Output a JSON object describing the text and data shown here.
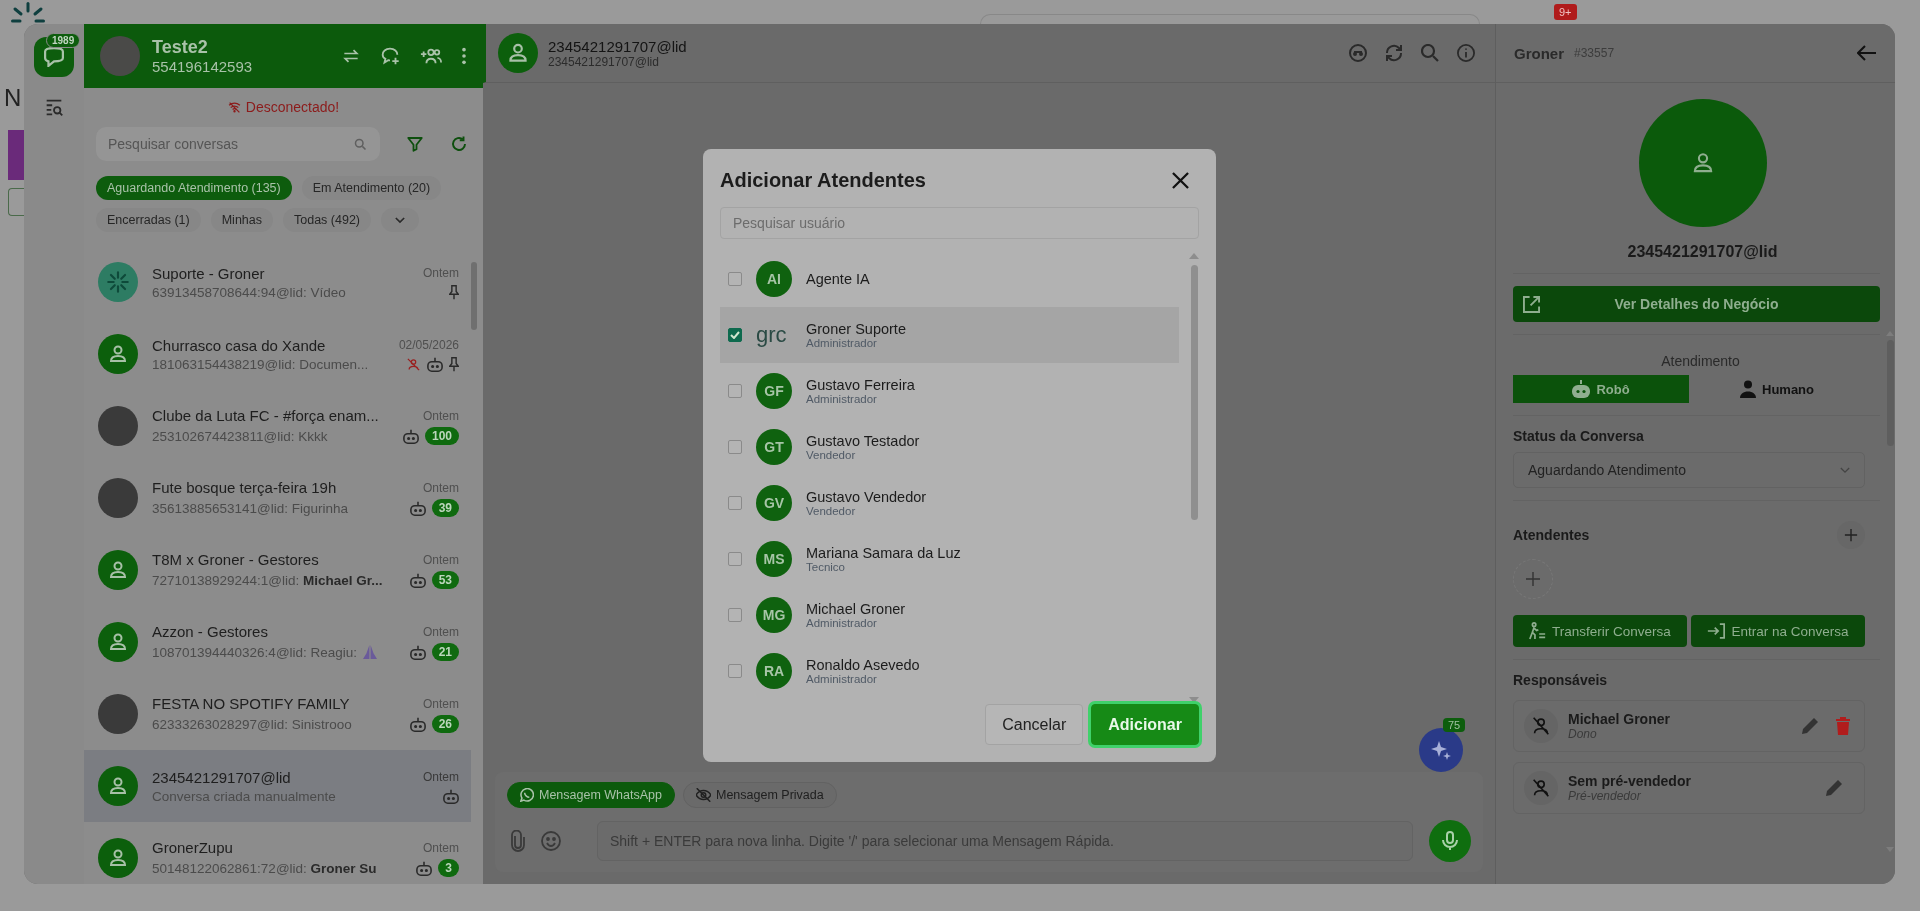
{
  "background": {
    "page_heading": "N",
    "notification_badge": "9+"
  },
  "nav": {
    "badge": "1989"
  },
  "account": {
    "name": "Teste2",
    "phone": "554196142593",
    "status": "Desconectado!"
  },
  "conversation_search": {
    "placeholder": "Pesquisar conversas"
  },
  "filters": [
    {
      "label": "Aguardando Atendimento (135)",
      "selected": true
    },
    {
      "label": "Em Atendimento (20)",
      "selected": false
    },
    {
      "label": "Encerradas (1)",
      "selected": false
    },
    {
      "label": "Minhas",
      "selected": false
    },
    {
      "label": "Todas (492)",
      "selected": false
    }
  ],
  "conversations": [
    {
      "name": "Suporte - Groner",
      "preview": "63913458708644:94@lid: Vídeo",
      "time": "Ontem",
      "avatar": {
        "kind": "logo"
      },
      "selected": false,
      "pinned": true,
      "bot": false,
      "unassigned": false,
      "reaction": false
    },
    {
      "name": "Churrasco casa do Xande",
      "preview": "181063154438219@lid: Documen...",
      "time": "02/05/2026",
      "avatar": {
        "kind": "person"
      },
      "selected": false,
      "pinned": true,
      "bot": true,
      "unassigned": true,
      "reaction": false
    },
    {
      "name": "Clube da Luta FC - #força enam...",
      "preview": "253102674423811@lid: Kkkk",
      "time": "Ontem",
      "avatar": {
        "kind": "photo"
      },
      "selected": false,
      "pinned": false,
      "bot": true,
      "unassigned": false,
      "unread": "100",
      "reaction": false
    },
    {
      "name": "Fute bosque terça-feira 19h",
      "preview": "35613885653141@lid: Figurinha",
      "time": "Ontem",
      "avatar": {
        "kind": "photo"
      },
      "selected": false,
      "pinned": false,
      "bot": true,
      "unassigned": false,
      "unread": "39",
      "reaction": false
    },
    {
      "name": "T8M x Groner - Gestores",
      "preview": "72710138929244:1@lid: **Michael Gr...**",
      "time": "Ontem",
      "avatar": {
        "kind": "person"
      },
      "selected": false,
      "pinned": false,
      "bot": true,
      "unassigned": false,
      "unread": "53",
      "reaction": false
    },
    {
      "name": "Azzon - Gestores",
      "preview": "108701394440326:4@lid: Reagiu:",
      "time": "Ontem",
      "avatar": {
        "kind": "person"
      },
      "selected": false,
      "pinned": false,
      "bot": true,
      "unassigned": false,
      "unread": "21",
      "reaction": true
    },
    {
      "name": "FESTA NO SPOTIFY FAMILY",
      "preview": "62333263028297@lid: Sinistrooo",
      "time": "Ontem",
      "avatar": {
        "kind": "photo"
      },
      "selected": false,
      "pinned": false,
      "bot": true,
      "unassigned": false,
      "unread": "26",
      "reaction": false
    },
    {
      "name": "2345421291707@lid",
      "preview": "Conversa criada manualmente",
      "time": "Ontem",
      "avatar": {
        "kind": "person"
      },
      "selected": true,
      "pinned": false,
      "bot": true,
      "unassigned": false,
      "reaction": false
    },
    {
      "name": "GronerZupu",
      "preview": "50148122062861:72@lid: **Groner Su**",
      "time": "Ontem",
      "avatar": {
        "kind": "person"
      },
      "selected": false,
      "pinned": false,
      "bot": true,
      "unassigned": false,
      "unread": "3",
      "reaction": false
    }
  ],
  "chat": {
    "title": "2345421291707@lid",
    "subtitle": "2345421291707@lid",
    "composer_tabs": [
      {
        "label": "Mensagem WhatsApp",
        "kind": "whatsapp",
        "selected": true
      },
      {
        "label": "Mensagem Privada",
        "kind": "private",
        "selected": false
      }
    ],
    "message_input": {
      "placeholder": "Shift + ENTER para nova linha. Digite '/' para selecionar uma Mensagem Rápida."
    },
    "assistant_badge": "75"
  },
  "details": {
    "title": "Groner",
    "id": "#33557",
    "contact": "2345421291707@lid",
    "deal_button": "Ver Detalhes do Negócio",
    "service_heading": "Atendimento",
    "service_modes": [
      {
        "label": "Robô",
        "kind": "bot",
        "selected": true
      },
      {
        "label": "Humano",
        "kind": "human",
        "selected": false
      }
    ],
    "status_heading": "Status da Conversa",
    "status_value": "Aguardando Atendimento",
    "agents_heading": "Atendentes",
    "actions": [
      {
        "label": "Transferir Conversa",
        "kind": "transfer"
      },
      {
        "label": "Entrar na Conversa",
        "kind": "enter"
      }
    ],
    "owners_heading": "Responsáveis",
    "owners": [
      {
        "name": "Michael Groner",
        "role": "Dono",
        "deletable": true
      },
      {
        "name": "Sem pré-vendedor",
        "role": "Pré-vendedor",
        "deletable": false
      }
    ]
  },
  "dialog": {
    "title": "Adicionar Atendentes",
    "search": {
      "placeholder": "Pesquisar usuário"
    },
    "users": [
      {
        "avatar": {
          "kind": "initials",
          "text": "AI"
        },
        "name": "Agente IA",
        "checked": false,
        "selected": false
      },
      {
        "avatar": {
          "kind": "logo",
          "text": "grc"
        },
        "name": "Groner Suporte",
        "role": "Administrador",
        "checked": true,
        "selected": true
      },
      {
        "avatar": {
          "kind": "initials",
          "text": "GF"
        },
        "name": "Gustavo Ferreira",
        "role": "Administrador",
        "checked": false,
        "selected": false
      },
      {
        "avatar": {
          "kind": "initials",
          "text": "GT"
        },
        "name": "Gustavo Testador",
        "role": "Vendedor",
        "checked": false,
        "selected": false
      },
      {
        "avatar": {
          "kind": "initials",
          "text": "GV"
        },
        "name": "Gustavo Vendedor",
        "role": "Vendedor",
        "checked": false,
        "selected": false
      },
      {
        "avatar": {
          "kind": "initials",
          "text": "MS"
        },
        "name": "Mariana Samara da Luz",
        "role": "Tecnico",
        "checked": false,
        "selected": false
      },
      {
        "avatar": {
          "kind": "initials",
          "text": "MG"
        },
        "name": "Michael Groner",
        "role": "Administrador",
        "checked": false,
        "selected": false
      },
      {
        "avatar": {
          "kind": "initials",
          "text": "RA"
        },
        "name": "Ronaldo Asevedo",
        "role": "Administrador",
        "checked": false,
        "selected": false
      }
    ],
    "buttons": [
      {
        "label": "Cancelar",
        "kind": "secondary"
      },
      {
        "label": "Adicionar",
        "kind": "primary"
      }
    ]
  }
}
